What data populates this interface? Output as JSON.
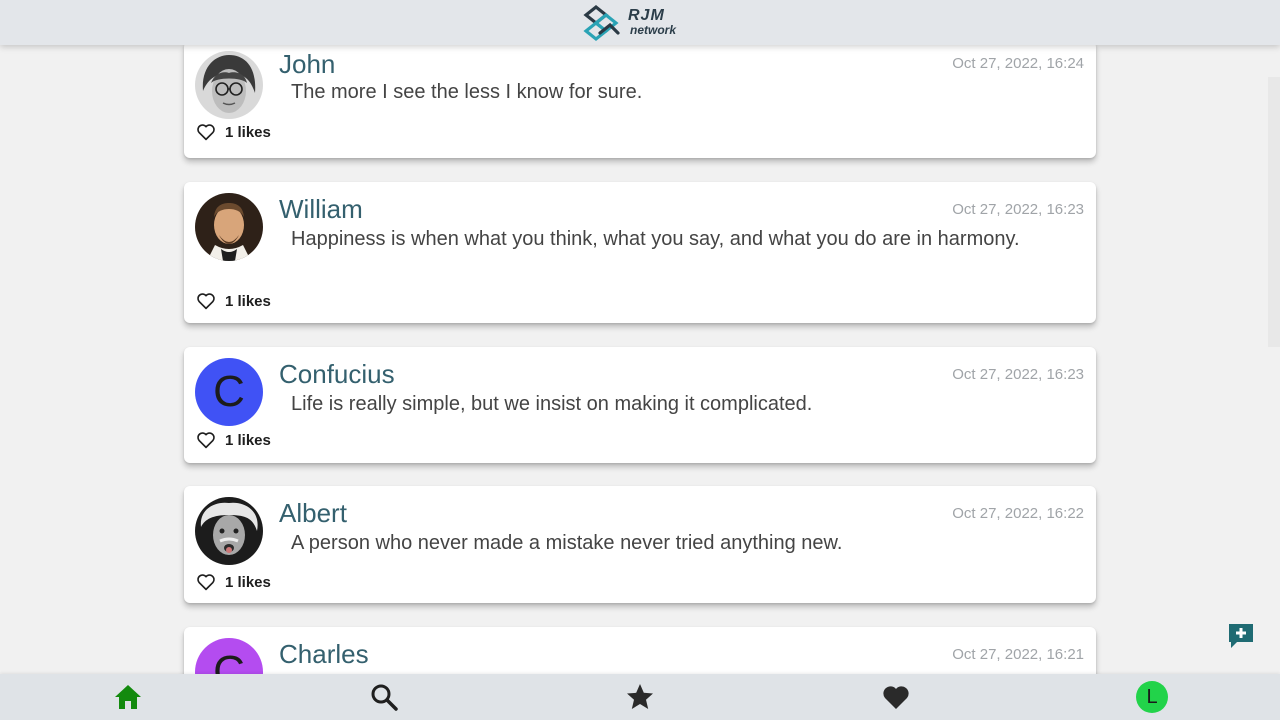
{
  "header": {
    "brand_line1": "RJM",
    "brand_line2": "network"
  },
  "posts": [
    {
      "author": "John",
      "date": "Oct 27, 2022, 16:24",
      "text": "The more I see the less I know for sure.",
      "likes": "1 likes",
      "avatar": "photo"
    },
    {
      "author": "William",
      "date": "Oct 27, 2022, 16:23",
      "text": "Happiness is when what you think, what you say, and what you do are in harmony.",
      "likes": "1 likes",
      "avatar": "photo"
    },
    {
      "author": "Confucius",
      "date": "Oct 27, 2022, 16:23",
      "text": "Life is really simple, but we insist on making it complicated.",
      "likes": "1 likes",
      "avatar_letter": "C",
      "avatar_color": "#4052f5"
    },
    {
      "author": "Albert",
      "date": "Oct 27, 2022, 16:22",
      "text": "A person who never made a mistake never tried anything new.",
      "likes": "1 likes",
      "avatar": "photo"
    },
    {
      "author": "Charles",
      "date": "Oct 27, 2022, 16:21",
      "avatar_letter": "C",
      "avatar_color": "#b44cf0"
    }
  ],
  "nav": {
    "items": [
      "home-icon",
      "search-icon",
      "star-icon",
      "heart-icon",
      "profile-avatar"
    ],
    "active_color": "#138a0e",
    "profile_letter": "L"
  },
  "colors": {
    "accent": "#1f6b73",
    "author": "#34606e"
  }
}
